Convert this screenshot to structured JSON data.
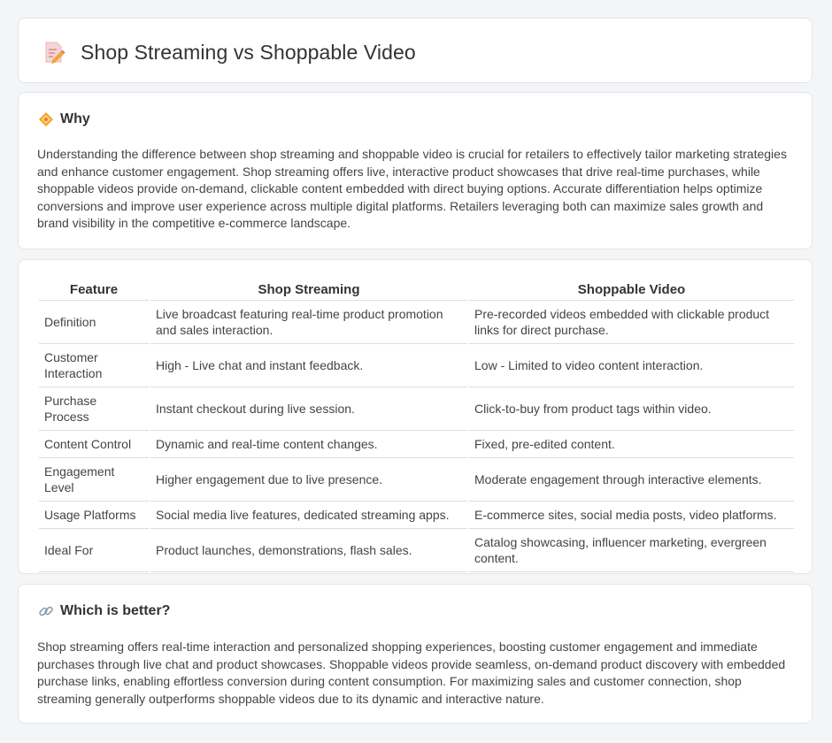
{
  "header": {
    "title": "Shop Streaming vs Shoppable Video"
  },
  "why": {
    "title": "Why",
    "text": "Understanding the difference between shop streaming and shoppable video is crucial for retailers to effectively tailor marketing strategies and enhance customer engagement. Shop streaming offers live, interactive product showcases that drive real-time purchases, while shoppable videos provide on-demand, clickable content embedded with direct buying options. Accurate differentiation helps optimize conversions and improve user experience across multiple digital platforms. Retailers leveraging both can maximize sales growth and brand visibility in the competitive e-commerce landscape."
  },
  "table": {
    "headers": [
      "Feature",
      "Shop Streaming",
      "Shoppable Video"
    ],
    "rows": [
      [
        "Definition",
        "Live broadcast featuring real-time product promotion and sales interaction.",
        "Pre-recorded videos embedded with clickable product links for direct purchase."
      ],
      [
        "Customer Interaction",
        "High - Live chat and instant feedback.",
        "Low - Limited to video content interaction."
      ],
      [
        "Purchase Process",
        "Instant checkout during live session.",
        "Click-to-buy from product tags within video."
      ],
      [
        "Content Control",
        "Dynamic and real-time content changes.",
        "Fixed, pre-edited content."
      ],
      [
        "Engagement Level",
        "Higher engagement due to live presence.",
        "Moderate engagement through interactive elements."
      ],
      [
        "Usage Platforms",
        "Social media live features, dedicated streaming apps.",
        "E-commerce sites, social media posts, video platforms."
      ],
      [
        "Ideal For",
        "Product launches, demonstrations, flash sales.",
        "Catalog showcasing, influencer marketing, evergreen content."
      ]
    ]
  },
  "better": {
    "title": "Which is better?",
    "text": "Shop streaming offers real-time interaction and personalized shopping experiences, boosting customer engagement and immediate purchases through live chat and product showcases. Shoppable videos provide seamless, on-demand product discovery with embedded purchase links, enabling effortless conversion during content consumption. For maximizing sales and customer connection, shop streaming generally outperforms shoppable videos due to its dynamic and interactive nature."
  }
}
